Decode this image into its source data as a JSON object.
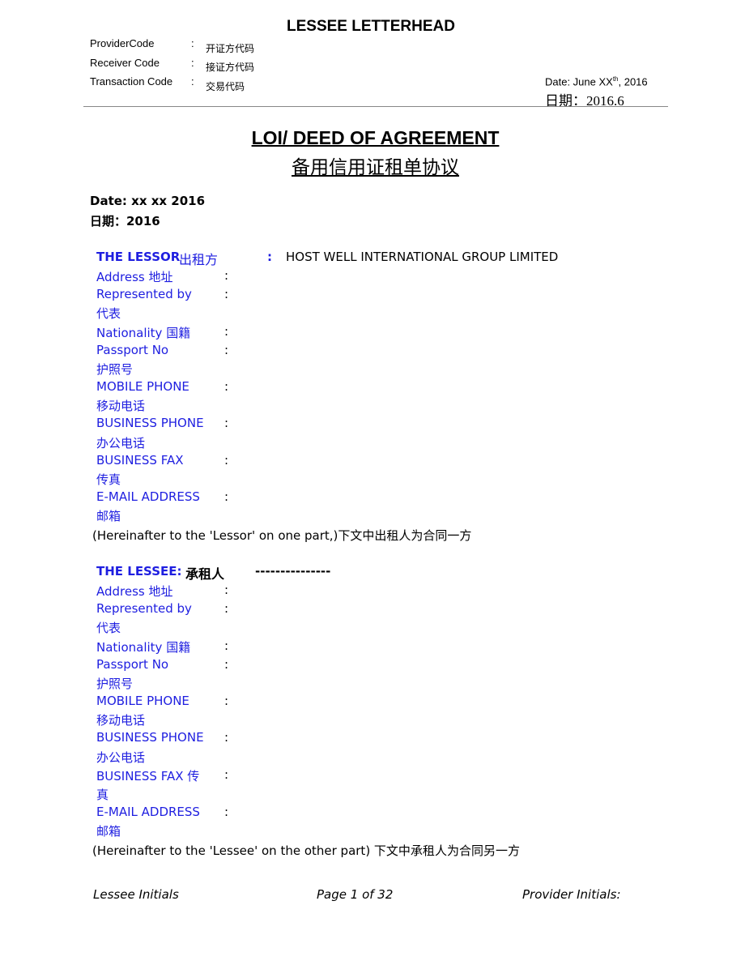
{
  "letterhead": {
    "title": "LESSEE LETTERHEAD",
    "codes": [
      {
        "label": "ProviderCode",
        "colon": ":",
        "value": "开证方代码"
      },
      {
        "label": "Receiver Code",
        "colon": ":",
        "value": "接证方代码"
      },
      {
        "label": "Transaction Code",
        "colon": ":",
        "value": "交易代码"
      }
    ],
    "date_prefix": "Date: June XX",
    "date_sup": "th",
    "date_suffix": ", 2016",
    "date_cn": "日期：2016.6"
  },
  "document": {
    "title": "LOI/ DEED OF AGREEMENT",
    "title_cn": "备用信用证租单协议",
    "date": "Date: xx  xx 2016",
    "date_cn": "日期：2016"
  },
  "lessor": {
    "heading": "THE LESSOR",
    "heading_cn": "出租方",
    "colon": ":",
    "name": "HOST WELL INTERNATIONAL GROUP LIMITED",
    "fields": [
      {
        "label": "Address 地址",
        "label2": "",
        "colon": ":"
      },
      {
        "label": "Represented by",
        "label2": "代表",
        "colon": ":"
      },
      {
        "label": "Nationality 国籍",
        "label2": "",
        "colon": ":"
      },
      {
        "label": "Passport No",
        "label2": "护照号",
        "colon": ":"
      },
      {
        "label": "MOBILE PHONE",
        "label2": "移动电话",
        "colon": ":"
      },
      {
        "label": "BUSINESS PHONE",
        "label2": "办公电话",
        "colon": ":"
      },
      {
        "label": "BUSINESS FAX",
        "label2": "传真",
        "colon": ":"
      },
      {
        "label": "E-MAIL ADDRESS",
        "label2": "邮箱",
        "colon": ":"
      }
    ],
    "note": "(Hereinafter to the 'Lessor' on one part,)下文中出租人为合同一方"
  },
  "lessee": {
    "heading": "THE LESSEE:",
    "heading_cn": "承租人",
    "dashes": "---------------",
    "fields": [
      {
        "label": "Address 地址",
        "label2": "",
        "colon": ":"
      },
      {
        "label": "Represented by",
        "label2": "代表",
        "colon": ":"
      },
      {
        "label": "Nationality 国籍",
        "label2": "",
        "colon": ":"
      },
      {
        "label": "Passport No",
        "label2": "护照号",
        "colon": ":"
      },
      {
        "label": "MOBILE PHONE",
        "label2": "移动电话",
        "colon": ":"
      },
      {
        "label": "BUSINESS PHONE",
        "label2": "办公电话",
        "colon": ":"
      },
      {
        "label": "BUSINESS FAX 传",
        "label2": "真",
        "colon": ":"
      },
      {
        "label": "E-MAIL ADDRESS",
        "label2": "邮箱",
        "colon": ":"
      }
    ],
    "note": "(Hereinafter to the 'Lessee' on the other part) 下文中承租人为合同另一方"
  },
  "footer": {
    "left": "Lessee Initials",
    "center": "Page 1 of 32",
    "right": "Provider Initials:"
  },
  "colors": {
    "label_blue": "#1e1ee0",
    "rule_gray": "#888888"
  }
}
